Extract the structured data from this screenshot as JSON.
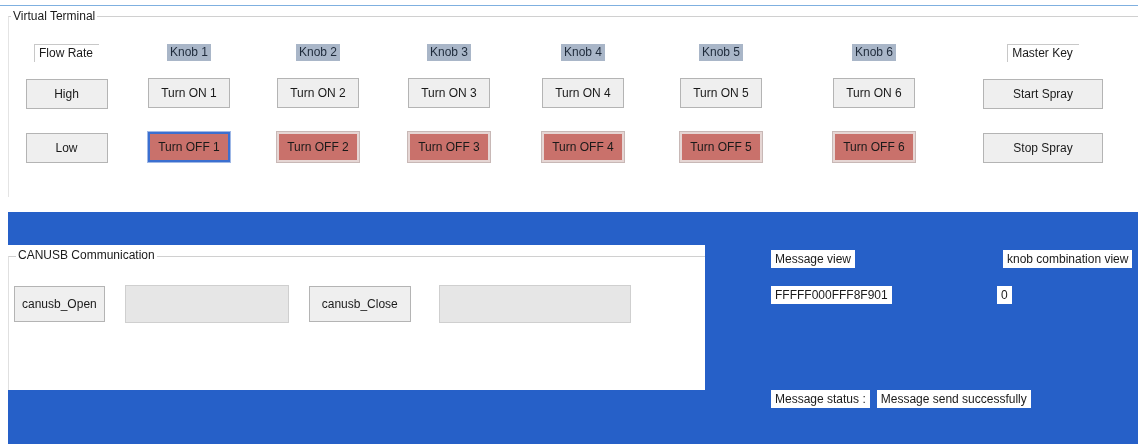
{
  "window": {
    "title": "Virtual Terminal"
  },
  "terminal": {
    "columns": [
      {
        "label": "Flow Rate",
        "kind": "field",
        "buttons": [
          {
            "label": "High",
            "kind": "normal",
            "focused": false
          },
          {
            "label": "Low",
            "kind": "normal",
            "focused": false
          }
        ]
      },
      {
        "label": "Knob 1",
        "kind": "knob",
        "buttons": [
          {
            "label": "Turn ON 1",
            "kind": "normal",
            "focused": false
          },
          {
            "label": "Turn OFF 1",
            "kind": "off",
            "focused": true
          }
        ]
      },
      {
        "label": "Knob 2",
        "kind": "knob",
        "buttons": [
          {
            "label": "Turn ON 2",
            "kind": "normal",
            "focused": false
          },
          {
            "label": "Turn OFF 2",
            "kind": "off",
            "focused": false
          }
        ]
      },
      {
        "label": "Knob 3",
        "kind": "knob",
        "buttons": [
          {
            "label": "Turn ON 3",
            "kind": "normal",
            "focused": false
          },
          {
            "label": "Turn OFF 3",
            "kind": "off",
            "focused": false
          }
        ]
      },
      {
        "label": "Knob 4",
        "kind": "knob",
        "buttons": [
          {
            "label": "Turn ON 4",
            "kind": "normal",
            "focused": false
          },
          {
            "label": "Turn OFF 4",
            "kind": "off",
            "focused": false
          }
        ]
      },
      {
        "label": "Knob 5",
        "kind": "knob",
        "buttons": [
          {
            "label": "Turn ON 5",
            "kind": "normal",
            "focused": false
          },
          {
            "label": "Turn OFF 5",
            "kind": "off",
            "focused": false
          }
        ]
      },
      {
        "label": "Knob 6",
        "kind": "knob",
        "buttons": [
          {
            "label": "Turn ON 6",
            "kind": "normal",
            "focused": false
          },
          {
            "label": "Turn OFF 6",
            "kind": "off",
            "focused": false
          }
        ]
      },
      {
        "label": "Master Key",
        "kind": "field",
        "buttons": [
          {
            "label": "Start Spray",
            "kind": "normal",
            "focused": false
          },
          {
            "label": "Stop Spray",
            "kind": "normal",
            "focused": false
          }
        ]
      }
    ]
  },
  "canusb": {
    "title": "CANUSB Communication",
    "controls": [
      {
        "kind": "button",
        "label": "canusb_Open"
      },
      {
        "kind": "field"
      },
      {
        "kind": "button",
        "label": "canusb_Close"
      },
      {
        "kind": "field"
      }
    ]
  },
  "messages": {
    "message_view": {
      "label": "Message view",
      "value": "FFFFF000FFF8F901"
    },
    "knob_view": {
      "label": "knob combination view",
      "value": "0"
    },
    "status": {
      "label": "Message status :",
      "value": "Message send successfully"
    }
  }
}
